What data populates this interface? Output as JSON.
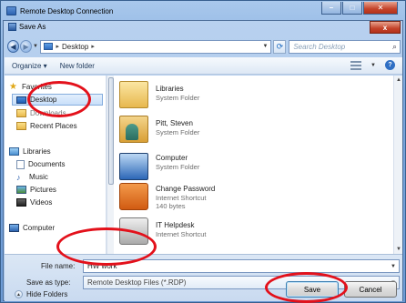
{
  "outer_window": {
    "title": "Remote Desktop Connection"
  },
  "dialog": {
    "title": "Save As",
    "close_glyph": "x"
  },
  "navbar": {
    "back_glyph": "◀",
    "forward_glyph": "▶",
    "address": "Desktop",
    "address_sep": "▸",
    "search_placeholder": "Search Desktop"
  },
  "toolbar": {
    "organize": "Organize ▾",
    "new_folder": "New folder"
  },
  "navpane": {
    "favorites": "Favorites",
    "desktop": "Desktop",
    "downloads": "Downloads",
    "recent": "Recent Places",
    "libraries": "Libraries",
    "documents": "Documents",
    "music": "Music",
    "pictures": "Pictures",
    "videos": "Videos",
    "computer": "Computer"
  },
  "files": [
    {
      "name": "Libraries",
      "sub1": "System Folder",
      "sub2": "",
      "icon": "library-icon"
    },
    {
      "name": "Pitt, Steven",
      "sub1": "System Folder",
      "sub2": "",
      "icon": "user-folder-icon"
    },
    {
      "name": "Computer",
      "sub1": "System Folder",
      "sub2": "",
      "icon": "computer-icon"
    },
    {
      "name": "Change Password",
      "sub1": "Internet Shortcut",
      "sub2": "140 bytes",
      "icon": "shortcut-icon"
    },
    {
      "name": "IT Helpdesk",
      "sub1": "Internet Shortcut",
      "sub2": "",
      "icon": "shortcut-icon"
    }
  ],
  "form": {
    "file_name_label": "File name:",
    "file_name_value": "HW work",
    "save_type_label": "Save as type:",
    "save_type_value": "Remote Desktop Files (*.RDP)"
  },
  "footer": {
    "hide_folders": "Hide Folders",
    "save": "Save",
    "cancel": "Cancel"
  },
  "colors": {
    "annotation": "#e3111b",
    "title_bar": "#7ba6dc"
  }
}
